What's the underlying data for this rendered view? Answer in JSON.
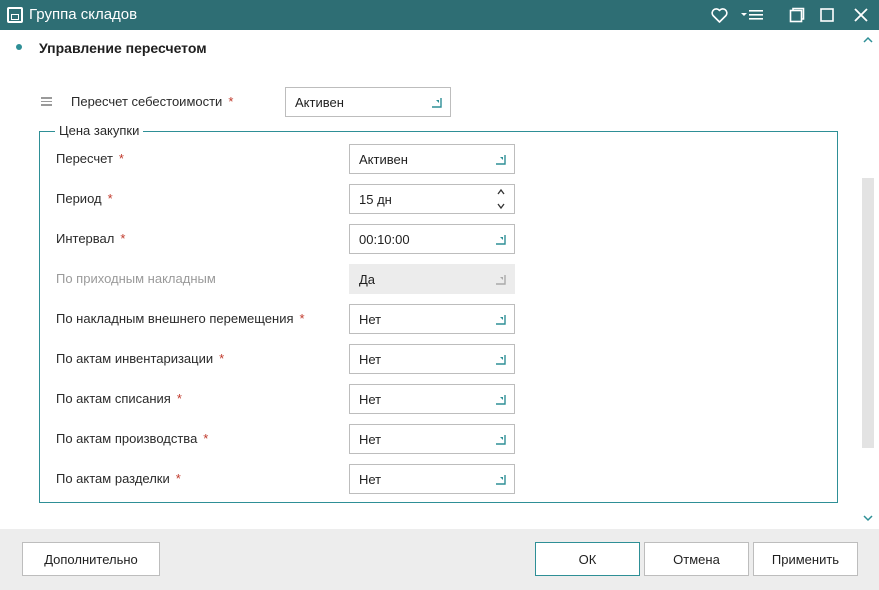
{
  "window": {
    "title": "Группа складов",
    "icons": [
      "heart-icon",
      "chevron-menu-icon",
      "restore-icon",
      "maximize-icon",
      "close-icon"
    ]
  },
  "section": {
    "title": "Управление пересчетом"
  },
  "cost_recalc": {
    "label": "Пересчет себестоимости",
    "required": "*",
    "value": "Активен"
  },
  "purchase_price": {
    "legend": "Цена закупки",
    "rows": [
      {
        "label": "Пересчет",
        "required": "*",
        "value": "Активен"
      },
      {
        "label": "Период",
        "required": "*",
        "value": "15 дн"
      },
      {
        "label": "Интервал",
        "required": "*",
        "value": "00:10:00"
      },
      {
        "label": "По приходным накладным",
        "required": "",
        "value": "Да"
      },
      {
        "label": "По накладным внешнего перемещения",
        "required": "*",
        "value": "Нет"
      },
      {
        "label": "По актам инвентаризации",
        "required": "*",
        "value": "Нет"
      },
      {
        "label": "По актам списания",
        "required": "*",
        "value": "Нет"
      },
      {
        "label": "По актам производства",
        "required": "*",
        "value": "Нет"
      },
      {
        "label": "По актам разделки",
        "required": "*",
        "value": "Нет"
      }
    ]
  },
  "footer": {
    "more": "Дополнительно",
    "ok": "ОК",
    "cancel": "Отмена",
    "apply": "Применить"
  },
  "colors": {
    "titlebar": "#2e6e74",
    "accent": "#2e8f96",
    "required": "#c0392b",
    "footer_bg": "#ededed"
  }
}
